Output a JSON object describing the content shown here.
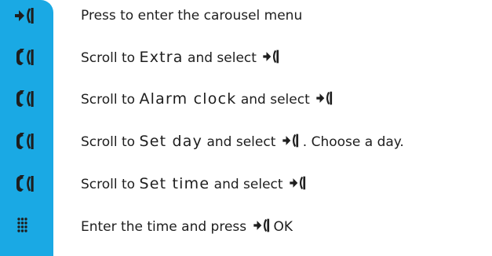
{
  "sidebar_color": "#1aa9e4",
  "steps": [
    {
      "icon": "menu-key-icon",
      "text": "Press to enter the carousel menu"
    },
    {
      "icon": "scroll-key-icon",
      "pre": "Scroll to ",
      "keyword": "Extra",
      "post": " and select",
      "tail": ""
    },
    {
      "icon": "scroll-key-icon",
      "pre": "Scroll to ",
      "keyword": "Alarm clock",
      "post": " and select",
      "tail": ""
    },
    {
      "icon": "scroll-key-icon",
      "pre": "Scroll to ",
      "keyword": "Set day",
      "post": " and select",
      "tail": ". Choose a day."
    },
    {
      "icon": "scroll-key-icon",
      "pre": "Scroll to ",
      "keyword": "Set time",
      "post": " and select",
      "tail": ""
    },
    {
      "icon": "keypad-icon",
      "pre": "Enter the time and press",
      "tail": "OK"
    }
  ]
}
